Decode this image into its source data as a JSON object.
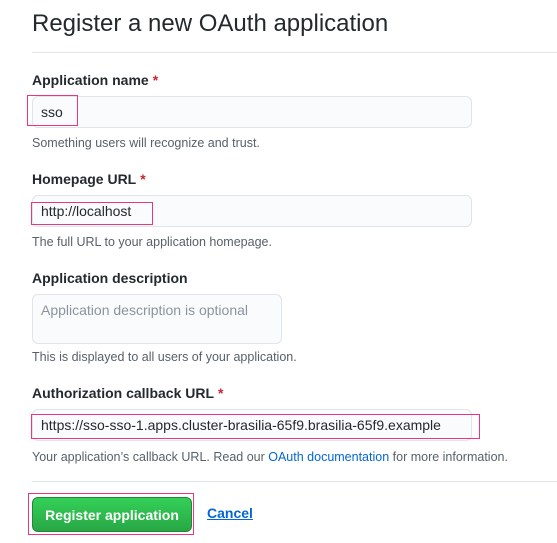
{
  "title": "Register a new OAuth application",
  "app_name": {
    "label": "Application name",
    "required": "*",
    "value": "sso",
    "note": "Something users will recognize and trust."
  },
  "homepage": {
    "label": "Homepage URL",
    "required": "*",
    "value": "http://localhost",
    "note": "The full URL to your application homepage."
  },
  "description": {
    "label": "Application description",
    "placeholder": "Application description is optional",
    "note": "This is displayed to all users of your application."
  },
  "callback": {
    "label": "Authorization callback URL",
    "required": "*",
    "value": "https://sso-sso-1.apps.cluster-brasilia-65f9.brasilia-65f9.example",
    "note_prefix": "Your application’s callback URL. Read our ",
    "note_link": "OAuth documentation",
    "note_suffix": " for more information."
  },
  "actions": {
    "register_label": "Register application",
    "cancel_label": "Cancel"
  },
  "colors": {
    "highlight": "#e8367f",
    "primary": "#2ea44f",
    "link": "#0366d6",
    "required": "#cb2431"
  }
}
